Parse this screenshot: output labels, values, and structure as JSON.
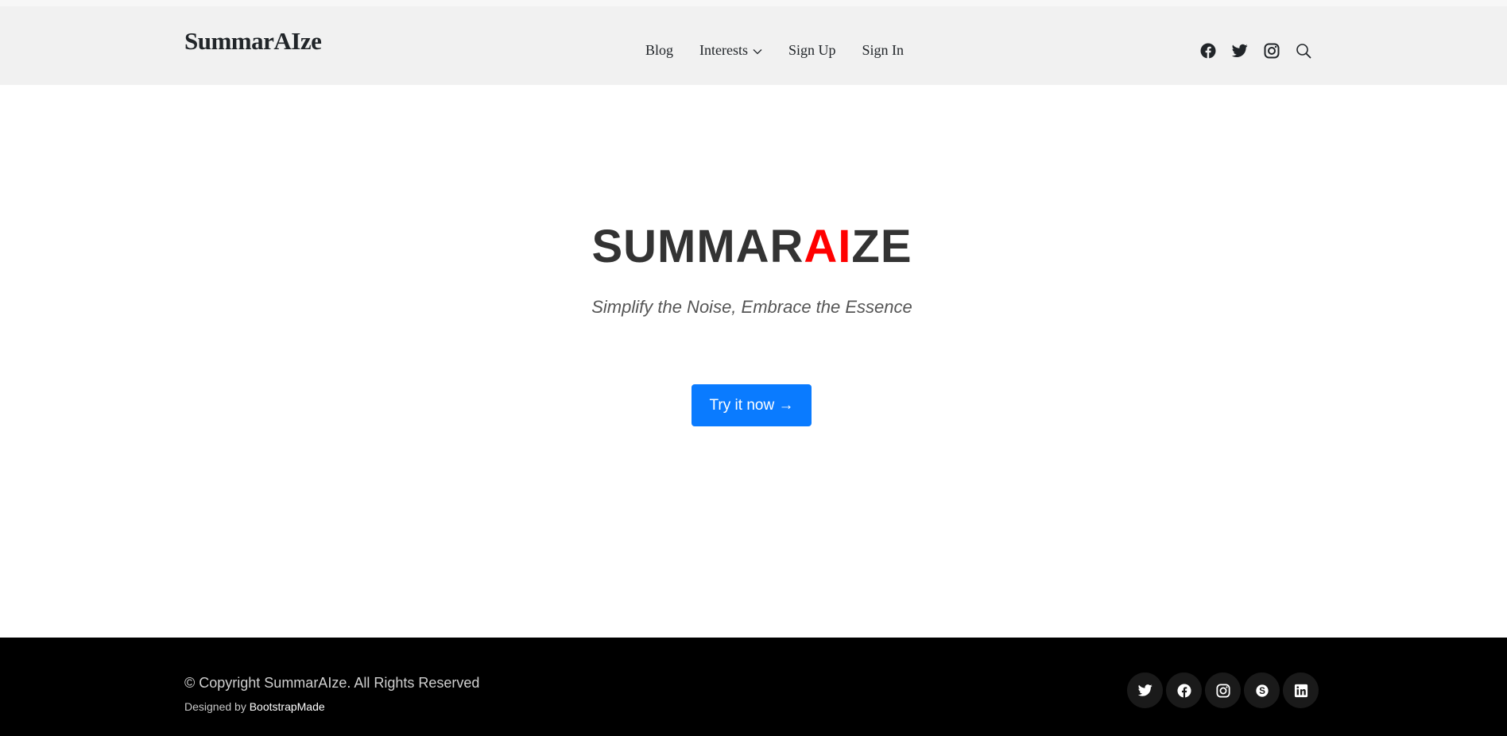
{
  "header": {
    "logo": "SummarAIze",
    "nav": [
      {
        "label": "Blog"
      },
      {
        "label": "Interests",
        "has_dropdown": true
      },
      {
        "label": "Sign Up"
      },
      {
        "label": "Sign In"
      }
    ],
    "icons": [
      "facebook-icon",
      "twitter-icon",
      "instagram-icon",
      "search-icon"
    ]
  },
  "hero": {
    "title_prefix": "SUMMAR",
    "title_accent": "AI",
    "title_suffix": "ZE",
    "tagline": "Simplify the Noise, Embrace the Essence",
    "cta_label": "Try it now →"
  },
  "footer": {
    "copyright": "© Copyright SummarAIze. All Rights Reserved",
    "designed_by_prefix": "Designed by",
    "designed_by_link": "BootstrapMade",
    "social_icons": [
      "twitter-icon",
      "facebook-icon",
      "instagram-icon",
      "skype-icon",
      "linkedin-icon"
    ]
  },
  "colors": {
    "accent_red": "#ff0000",
    "cta_blue": "#0a7bff",
    "header_bg": "#f1f1f1",
    "footer_bg": "#000000"
  }
}
